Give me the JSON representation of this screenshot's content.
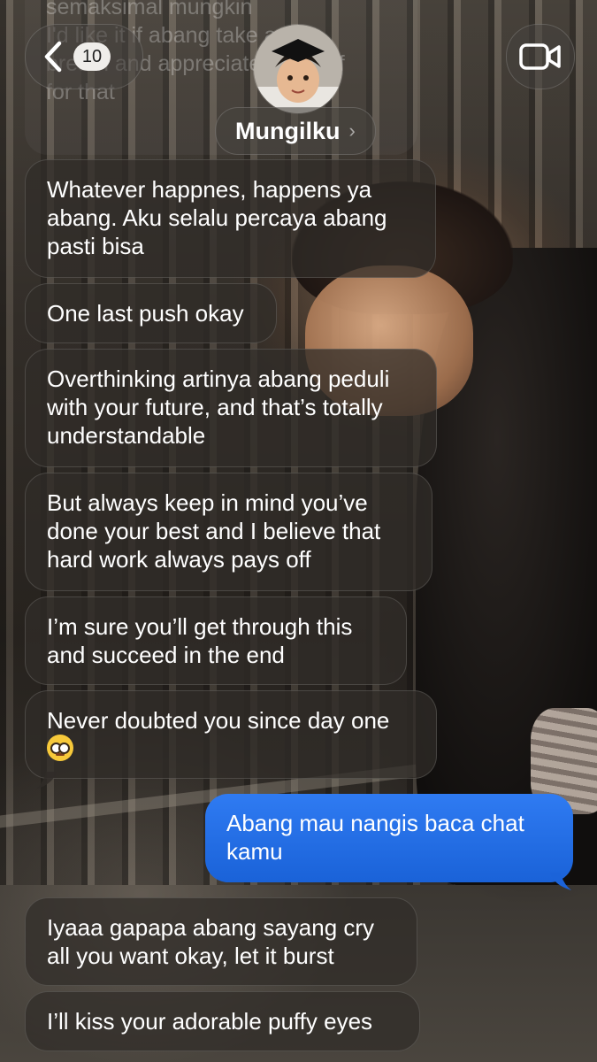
{
  "header": {
    "unread_count": "10",
    "contact_name": "Mungilku",
    "name_chevron": "›",
    "back_icon": "chevron-left-icon",
    "video_icon": "video-camera-icon"
  },
  "previous_message_fragment": {
    "line1": "semaksimal mungkin",
    "line2": "I'd like it if abang take a",
    "line3": "breath and appreciate yourself",
    "line4": "for that"
  },
  "messages": [
    {
      "id": 1,
      "direction": "incoming",
      "lines": [
        "Whatever happnes, happens ya",
        "abang. Aku selalu percaya abang",
        "pasti bisa"
      ]
    },
    {
      "id": 2,
      "direction": "incoming",
      "lines": [
        "One last push okay"
      ]
    },
    {
      "id": 3,
      "direction": "incoming",
      "lines": [
        "Overthinking artinya abang peduli",
        "with your future, and that’s totally",
        "understandable"
      ]
    },
    {
      "id": 4,
      "direction": "incoming",
      "lines": [
        "But always keep in mind you’ve",
        "done your best and I believe that",
        "hard work always pays off"
      ]
    },
    {
      "id": 5,
      "direction": "incoming",
      "lines": [
        "I’m sure you’ll get through this",
        "and succeed in the end"
      ]
    },
    {
      "id": 6,
      "direction": "incoming",
      "lines": [
        "Never doubted you since day one"
      ],
      "emoji": "nerd-face-emoji"
    },
    {
      "id": 7,
      "direction": "outgoing",
      "lines": [
        "Abang mau nangis baca chat",
        "kamu"
      ]
    },
    {
      "id": 8,
      "direction": "incoming",
      "lines": [
        "Iyaaa gapapa abang sayang cry",
        "all you want okay, let it burst"
      ]
    },
    {
      "id": 9,
      "direction": "incoming",
      "lines": [
        "I’ll kiss your adorable puffy eyes"
      ]
    }
  ],
  "colors": {
    "incoming_bubble": "#302c28",
    "outgoing_bubble": "#2a73ea",
    "badge_bg": "#efedea",
    "text": "#ffffff"
  }
}
